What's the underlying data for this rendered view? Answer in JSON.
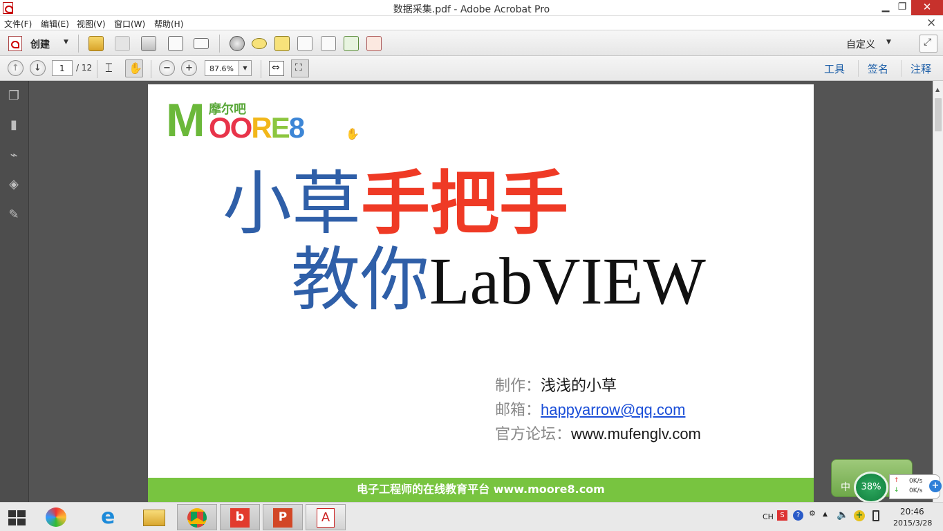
{
  "window": {
    "title": "数据采集.pdf - Adobe Acrobat Pro",
    "min_icon": "minimize-icon",
    "max_icon": "restore-icon",
    "close_label": "✕"
  },
  "menu": {
    "items": [
      "文件(F)",
      "编辑(E)",
      "视图(V)",
      "窗口(W)",
      "帮助(H)"
    ],
    "close_doc": "×"
  },
  "toolbar": {
    "create_label": "创建",
    "customize_label": "自定义"
  },
  "nav": {
    "page_current": "1",
    "page_total": "/ 12",
    "zoom": "87.6%"
  },
  "right_tabs": [
    "工具",
    "签名",
    "注释"
  ],
  "document": {
    "logo_m": "M",
    "logo_oo": "OO",
    "logo_r": "R",
    "logo_e": "E",
    "logo_8": "8",
    "logo_cn": "摩尔吧",
    "headline1_blue": "小草",
    "headline1_red": "手把手",
    "headline2_blue": "教你",
    "headline2_black": "LabVIEW",
    "author_label": "制作：",
    "author_value": "浅浅的小草",
    "email_label": "邮箱：",
    "email_value": "happyarrow@qq.com",
    "forum_label": "官方论坛：",
    "forum_value": "www.mufenglv.com",
    "footer": "电子工程师的在线教育平台 www.moore8.com"
  },
  "widget": {
    "zh": "中",
    "percent": "38%",
    "up_speed": "0K/s",
    "down_speed": "0K/s"
  },
  "tray": {
    "lang": "CH",
    "time": "20:46",
    "date": "2015/3/28"
  },
  "colors": {
    "accent_blue": "#1d5fa8",
    "footer_green": "#78c440",
    "headline_red": "#ef3a25",
    "headline_blue": "#2f5fa8"
  }
}
